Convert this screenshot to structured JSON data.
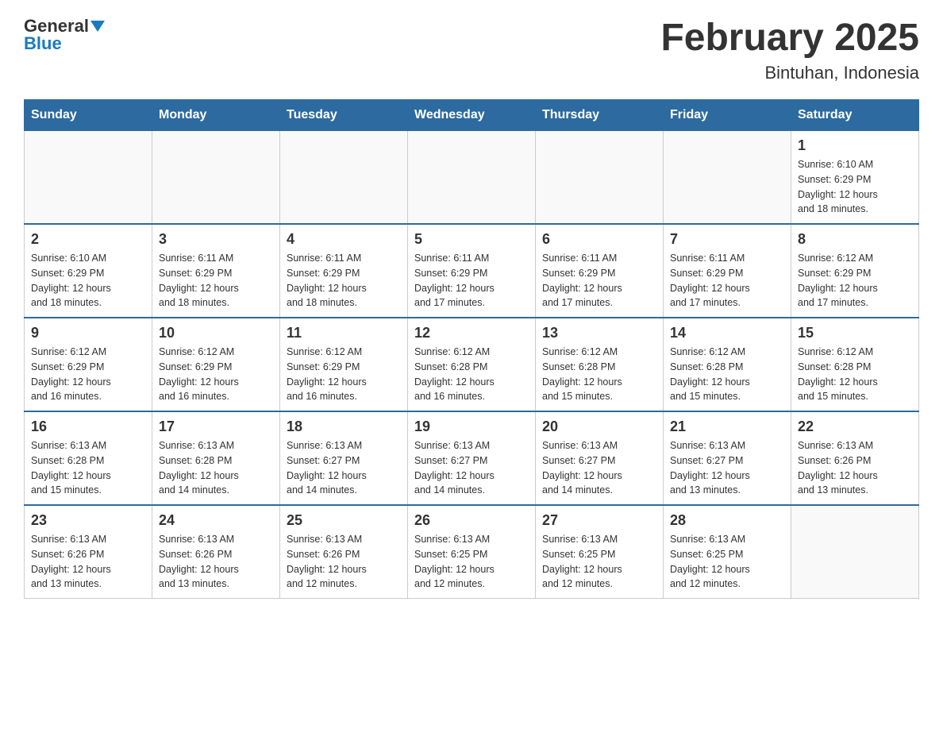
{
  "header": {
    "logo_general": "General",
    "logo_blue": "Blue",
    "month_title": "February 2025",
    "location": "Bintuhan, Indonesia"
  },
  "days_of_week": [
    "Sunday",
    "Monday",
    "Tuesday",
    "Wednesday",
    "Thursday",
    "Friday",
    "Saturday"
  ],
  "weeks": [
    {
      "days": [
        {
          "number": "",
          "info": ""
        },
        {
          "number": "",
          "info": ""
        },
        {
          "number": "",
          "info": ""
        },
        {
          "number": "",
          "info": ""
        },
        {
          "number": "",
          "info": ""
        },
        {
          "number": "",
          "info": ""
        },
        {
          "number": "1",
          "info": "Sunrise: 6:10 AM\nSunset: 6:29 PM\nDaylight: 12 hours\nand 18 minutes."
        }
      ]
    },
    {
      "days": [
        {
          "number": "2",
          "info": "Sunrise: 6:10 AM\nSunset: 6:29 PM\nDaylight: 12 hours\nand 18 minutes."
        },
        {
          "number": "3",
          "info": "Sunrise: 6:11 AM\nSunset: 6:29 PM\nDaylight: 12 hours\nand 18 minutes."
        },
        {
          "number": "4",
          "info": "Sunrise: 6:11 AM\nSunset: 6:29 PM\nDaylight: 12 hours\nand 18 minutes."
        },
        {
          "number": "5",
          "info": "Sunrise: 6:11 AM\nSunset: 6:29 PM\nDaylight: 12 hours\nand 17 minutes."
        },
        {
          "number": "6",
          "info": "Sunrise: 6:11 AM\nSunset: 6:29 PM\nDaylight: 12 hours\nand 17 minutes."
        },
        {
          "number": "7",
          "info": "Sunrise: 6:11 AM\nSunset: 6:29 PM\nDaylight: 12 hours\nand 17 minutes."
        },
        {
          "number": "8",
          "info": "Sunrise: 6:12 AM\nSunset: 6:29 PM\nDaylight: 12 hours\nand 17 minutes."
        }
      ]
    },
    {
      "days": [
        {
          "number": "9",
          "info": "Sunrise: 6:12 AM\nSunset: 6:29 PM\nDaylight: 12 hours\nand 16 minutes."
        },
        {
          "number": "10",
          "info": "Sunrise: 6:12 AM\nSunset: 6:29 PM\nDaylight: 12 hours\nand 16 minutes."
        },
        {
          "number": "11",
          "info": "Sunrise: 6:12 AM\nSunset: 6:29 PM\nDaylight: 12 hours\nand 16 minutes."
        },
        {
          "number": "12",
          "info": "Sunrise: 6:12 AM\nSunset: 6:28 PM\nDaylight: 12 hours\nand 16 minutes."
        },
        {
          "number": "13",
          "info": "Sunrise: 6:12 AM\nSunset: 6:28 PM\nDaylight: 12 hours\nand 15 minutes."
        },
        {
          "number": "14",
          "info": "Sunrise: 6:12 AM\nSunset: 6:28 PM\nDaylight: 12 hours\nand 15 minutes."
        },
        {
          "number": "15",
          "info": "Sunrise: 6:12 AM\nSunset: 6:28 PM\nDaylight: 12 hours\nand 15 minutes."
        }
      ]
    },
    {
      "days": [
        {
          "number": "16",
          "info": "Sunrise: 6:13 AM\nSunset: 6:28 PM\nDaylight: 12 hours\nand 15 minutes."
        },
        {
          "number": "17",
          "info": "Sunrise: 6:13 AM\nSunset: 6:28 PM\nDaylight: 12 hours\nand 14 minutes."
        },
        {
          "number": "18",
          "info": "Sunrise: 6:13 AM\nSunset: 6:27 PM\nDaylight: 12 hours\nand 14 minutes."
        },
        {
          "number": "19",
          "info": "Sunrise: 6:13 AM\nSunset: 6:27 PM\nDaylight: 12 hours\nand 14 minutes."
        },
        {
          "number": "20",
          "info": "Sunrise: 6:13 AM\nSunset: 6:27 PM\nDaylight: 12 hours\nand 14 minutes."
        },
        {
          "number": "21",
          "info": "Sunrise: 6:13 AM\nSunset: 6:27 PM\nDaylight: 12 hours\nand 13 minutes."
        },
        {
          "number": "22",
          "info": "Sunrise: 6:13 AM\nSunset: 6:26 PM\nDaylight: 12 hours\nand 13 minutes."
        }
      ]
    },
    {
      "days": [
        {
          "number": "23",
          "info": "Sunrise: 6:13 AM\nSunset: 6:26 PM\nDaylight: 12 hours\nand 13 minutes."
        },
        {
          "number": "24",
          "info": "Sunrise: 6:13 AM\nSunset: 6:26 PM\nDaylight: 12 hours\nand 13 minutes."
        },
        {
          "number": "25",
          "info": "Sunrise: 6:13 AM\nSunset: 6:26 PM\nDaylight: 12 hours\nand 12 minutes."
        },
        {
          "number": "26",
          "info": "Sunrise: 6:13 AM\nSunset: 6:25 PM\nDaylight: 12 hours\nand 12 minutes."
        },
        {
          "number": "27",
          "info": "Sunrise: 6:13 AM\nSunset: 6:25 PM\nDaylight: 12 hours\nand 12 minutes."
        },
        {
          "number": "28",
          "info": "Sunrise: 6:13 AM\nSunset: 6:25 PM\nDaylight: 12 hours\nand 12 minutes."
        },
        {
          "number": "",
          "info": ""
        }
      ]
    }
  ]
}
